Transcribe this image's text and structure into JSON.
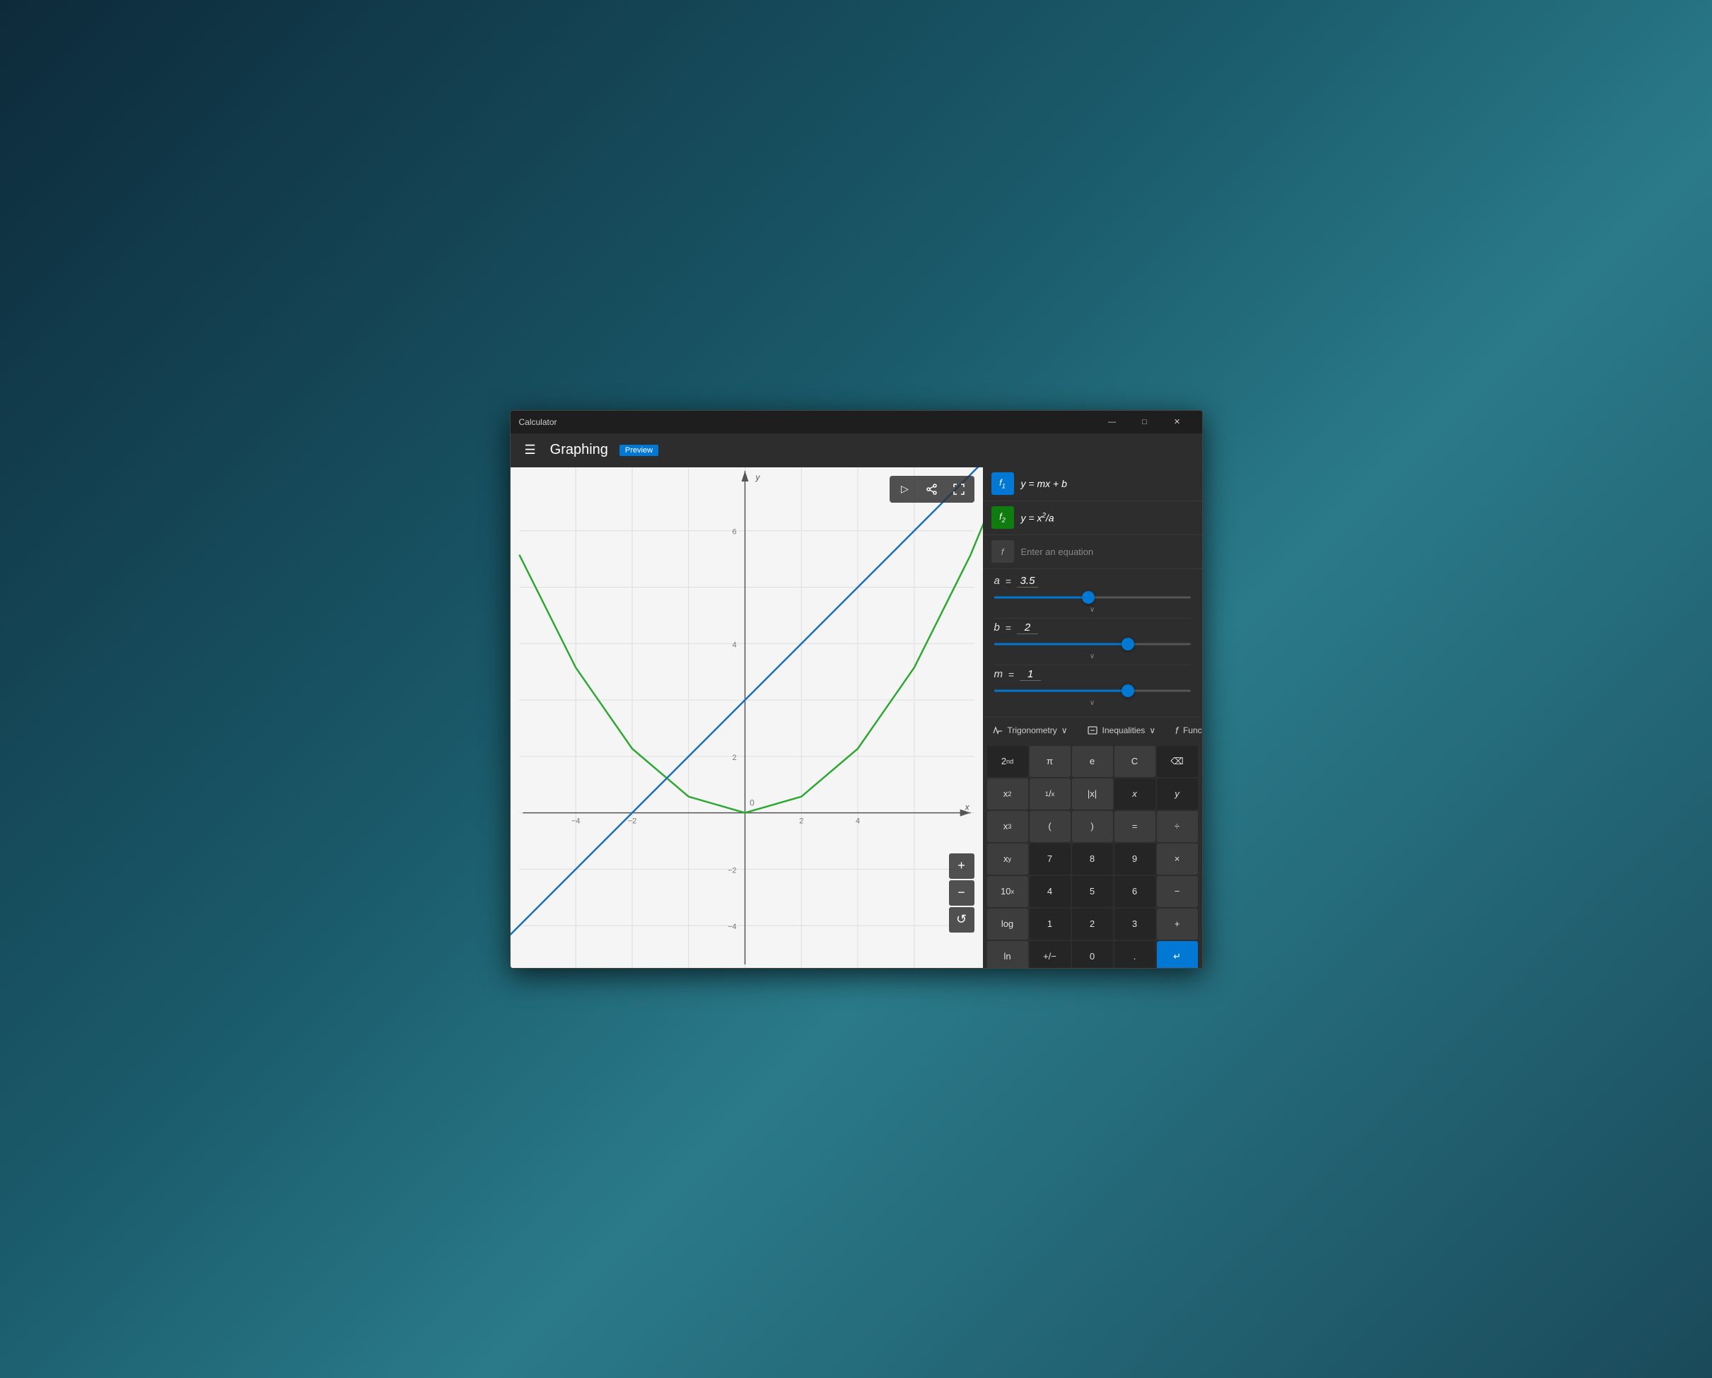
{
  "window": {
    "title": "Calculator",
    "controls": {
      "minimize": "—",
      "maximize": "□",
      "close": "✕"
    }
  },
  "header": {
    "title": "Graphing",
    "badge": "Preview"
  },
  "equations": [
    {
      "id": "f1",
      "badge": "f₁",
      "color": "blue",
      "text": "y = mx + b"
    },
    {
      "id": "f2",
      "badge": "f₂",
      "color": "green",
      "text": "y = x²/a"
    },
    {
      "id": "f3",
      "badge": "f",
      "color": "gray",
      "placeholder": "Enter an equation"
    }
  ],
  "variables": [
    {
      "name": "a",
      "value": "3.5",
      "sliderPercent": 48
    },
    {
      "name": "b",
      "value": "2",
      "sliderPercent": 68
    },
    {
      "name": "m",
      "value": "1",
      "sliderPercent": 68
    }
  ],
  "keyboard_toolbar": [
    {
      "icon": "△",
      "label": "Trigonometry",
      "hasDropdown": true
    },
    {
      "icon": "□",
      "label": "Inequalities",
      "hasDropdown": true
    },
    {
      "icon": "f",
      "label": "Function",
      "hasDropdown": true
    }
  ],
  "keys": [
    {
      "label": "2nd",
      "style": "dark",
      "superscript": "nd"
    },
    {
      "label": "π"
    },
    {
      "label": "e"
    },
    {
      "label": "C"
    },
    {
      "label": "⌫",
      "style": "dark"
    },
    {
      "label": "x²",
      "superscript": "2"
    },
    {
      "label": "¹/x"
    },
    {
      "label": "|x|"
    },
    {
      "label": "x",
      "style": "dark"
    },
    {
      "label": "y",
      "style": "dark"
    },
    {
      "label": "x³",
      "superscript": "3"
    },
    {
      "label": "("
    },
    {
      "label": ")"
    },
    {
      "label": "="
    },
    {
      "label": "÷"
    },
    {
      "label": "xʸ"
    },
    {
      "label": "7"
    },
    {
      "label": "8"
    },
    {
      "label": "9"
    },
    {
      "label": "×"
    },
    {
      "label": "10ˣ"
    },
    {
      "label": "4"
    },
    {
      "label": "5"
    },
    {
      "label": "6"
    },
    {
      "label": "−"
    },
    {
      "label": "log"
    },
    {
      "label": "1"
    },
    {
      "label": "2"
    },
    {
      "label": "3"
    },
    {
      "label": "+"
    },
    {
      "label": "ln"
    },
    {
      "label": "+/−"
    },
    {
      "label": "0"
    },
    {
      "label": "."
    },
    {
      "label": "↵",
      "style": "blue"
    }
  ],
  "graph": {
    "xMin": -4,
    "xMax": 4,
    "yMin": -4,
    "yMax": 8,
    "xLabel": "x",
    "yLabel": "y",
    "gridLines": [
      -4,
      -2,
      0,
      2,
      4,
      6
    ],
    "xGridLines": [
      -4,
      -2,
      0,
      2,
      4
    ]
  },
  "zoom_controls": {
    "plus": "+",
    "minus": "−",
    "reset": "↺"
  },
  "tools": [
    {
      "icon": "▷",
      "name": "cursor-tool"
    },
    {
      "icon": "↗",
      "name": "share-tool"
    },
    {
      "icon": "⛶",
      "name": "fullscreen-tool"
    }
  ]
}
